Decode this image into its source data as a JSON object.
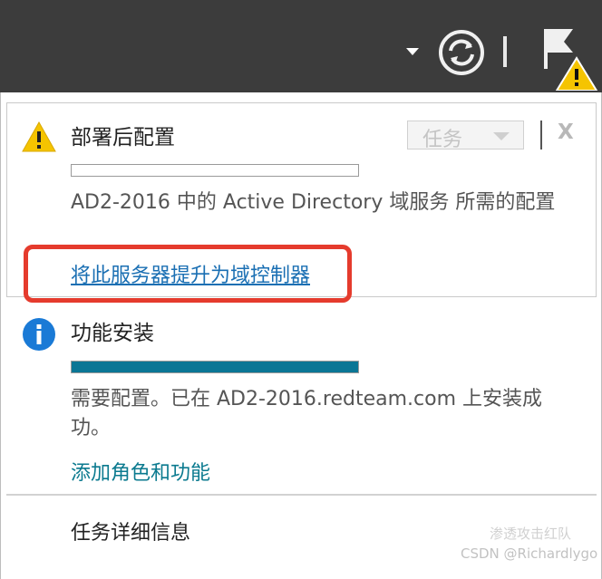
{
  "toolbar": {
    "refresh_icon": "refresh-icon",
    "flag_icon": "notification-flag-icon",
    "warning_badge_icon": "warning-badge-icon"
  },
  "notifications": {
    "post_deploy": {
      "title": "部署后配置",
      "task_label": "任务",
      "close_label": "X",
      "progress": 0,
      "description": "AD2-2016 中的 Active Directory 域服务 所需的配置",
      "link": "将此服务器提升为域控制器",
      "icon": "warning-icon"
    },
    "feature_install": {
      "title": "功能安装",
      "progress": 1.0,
      "description": "需要配置。已在 AD2-2016.redteam.com 上安装成功。",
      "link": "添加角色和功能",
      "icon": "info-icon"
    },
    "task_details": "任务详细信息"
  },
  "colors": {
    "toolbar_bg": "#3c3c3c",
    "progress_fill": "#0b7695",
    "highlight_box": "#e53b2d",
    "link_blue": "#1a6fb3",
    "link_teal": "#0b7a8f",
    "warning_yellow": "#f5c400",
    "info_blue": "#1a7ad6"
  },
  "watermark": {
    "line1": "渗透攻击红队",
    "line2": "CSDN @Richardlygo"
  }
}
